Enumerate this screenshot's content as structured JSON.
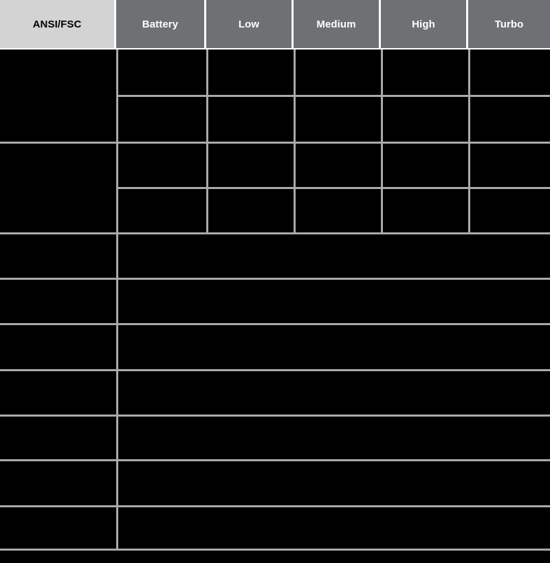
{
  "table": {
    "columns": [
      {
        "key": "ansi_fsc",
        "label": "ANSI/FSC"
      },
      {
        "key": "battery",
        "label": "Battery"
      },
      {
        "key": "low",
        "label": "Low"
      },
      {
        "key": "medium",
        "label": "Medium"
      },
      {
        "key": "high",
        "label": "High"
      },
      {
        "key": "turbo",
        "label": "Turbo"
      }
    ],
    "colors": {
      "header_label_bg": "#d3d3d3",
      "header_label_text": "#000000",
      "header_mode_bg": "#6e7074",
      "header_mode_text": "#ffffff",
      "body_bg": "#000000",
      "body_text": "#000000",
      "grid_line": "#a8aaad",
      "header_divider": "#ffffff"
    },
    "upper_section": {
      "label_cells": [
        {
          "text": ""
        },
        {
          "text": ""
        }
      ],
      "rows": [
        {
          "battery": "",
          "low": "",
          "medium": "",
          "high": "",
          "turbo": ""
        },
        {
          "battery": "",
          "low": "",
          "medium": "",
          "high": "",
          "turbo": ""
        },
        {
          "battery": "",
          "low": "",
          "medium": "",
          "high": "",
          "turbo": ""
        },
        {
          "battery": "",
          "low": "",
          "medium": "",
          "high": "",
          "turbo": ""
        }
      ]
    },
    "lower_section": {
      "rows": [
        {
          "label": "",
          "value": ""
        },
        {
          "label": "",
          "value": ""
        },
        {
          "label": "",
          "value": ""
        },
        {
          "label": "",
          "value": ""
        },
        {
          "label": "",
          "value": ""
        },
        {
          "label": "",
          "value": ""
        },
        {
          "label": "",
          "value": ""
        }
      ]
    }
  }
}
